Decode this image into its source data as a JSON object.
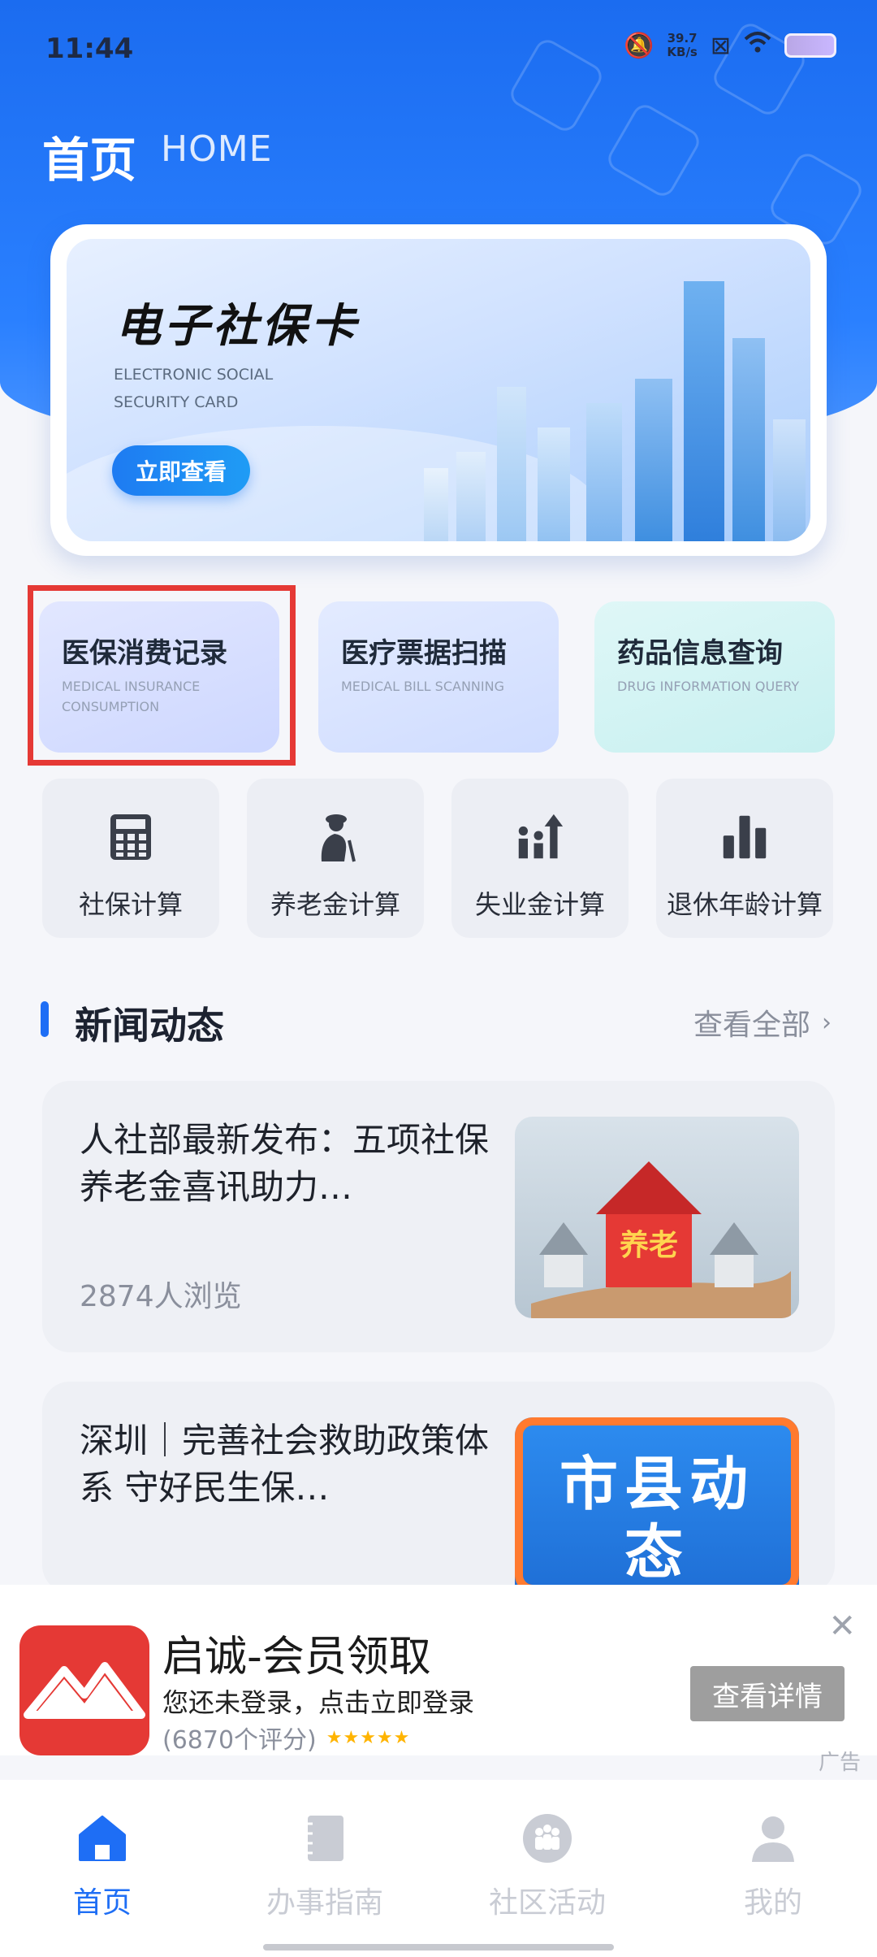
{
  "status_bar": {
    "time": "11:44",
    "net_speed": "39.7",
    "net_unit": "KB/s"
  },
  "header": {
    "title": "首页",
    "subtitle": "HOME"
  },
  "banner": {
    "title": "电子社保卡",
    "subtitle": "ELECTRONIC SOCIAL SECURITY CARD",
    "button": "立即查看"
  },
  "features": [
    {
      "title": "医保消费记录",
      "en": "MEDICAL INSURANCE CONSUMPTION"
    },
    {
      "title": "医疗票据扫描",
      "en": "MEDICAL BILL SCANNING"
    },
    {
      "title": "药品信息查询",
      "en": "DRUG INFORMATION QUERY"
    }
  ],
  "calculators": [
    {
      "label": "社保计算",
      "icon": "calculator-icon"
    },
    {
      "label": "养老金计算",
      "icon": "elderly-icon"
    },
    {
      "label": "失业金计算",
      "icon": "growth-chart-icon"
    },
    {
      "label": "退休年龄计算",
      "icon": "bar-chart-icon"
    }
  ],
  "news_section": {
    "title": "新闻动态",
    "view_all": "查看全部"
  },
  "news": [
    {
      "title": "人社部最新发布：五项社保养老金喜讯助力…",
      "views": "2874人浏览",
      "image_text": "养老"
    },
    {
      "title": "深圳｜完善社会救助政策体系 守好民生保…",
      "views": "",
      "image_text": "市县动态"
    }
  ],
  "ad": {
    "title": "启诚-会员领取",
    "subtitle": "您还未登录，点击立即登录",
    "rating": "(6870个评分)",
    "stars": "★★★★★",
    "button": "查看详情",
    "label": "广告"
  },
  "bottom_nav": [
    {
      "label": "首页",
      "icon": "home-icon",
      "active": true
    },
    {
      "label": "办事指南",
      "icon": "guide-book-icon",
      "active": false
    },
    {
      "label": "社区活动",
      "icon": "community-icon",
      "active": false
    },
    {
      "label": "我的",
      "icon": "profile-icon",
      "active": false
    }
  ],
  "colors": {
    "primary": "#1e6ef5",
    "highlight": "#e53935",
    "ad_icon": "#e53935"
  }
}
